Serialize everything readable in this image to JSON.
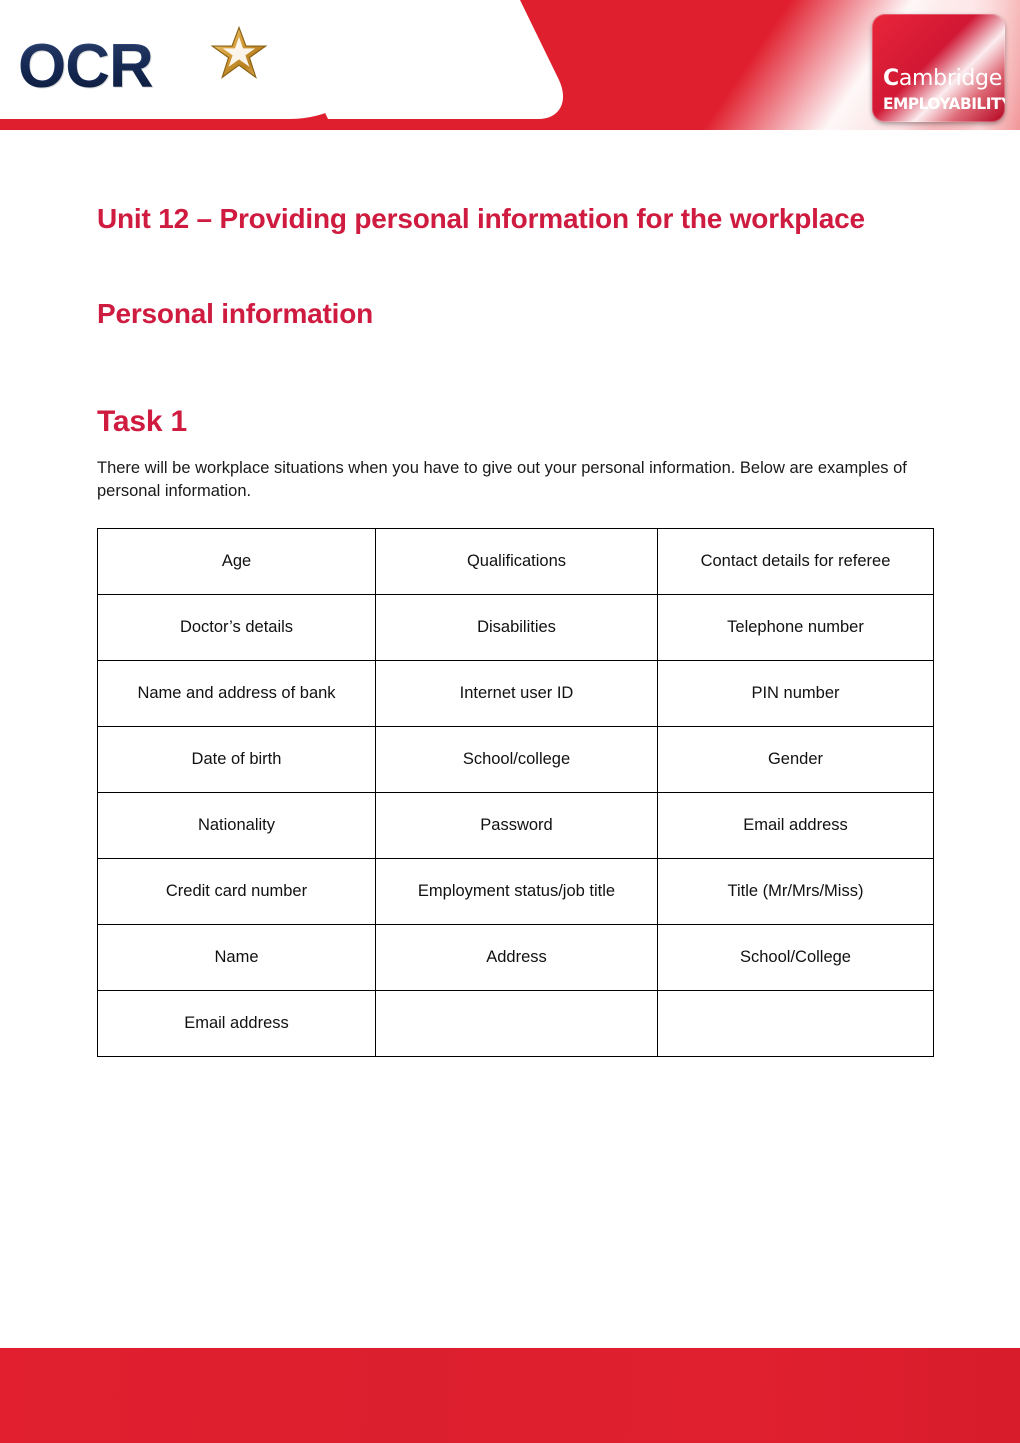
{
  "header": {
    "ocr_logo": {
      "text": "OCR",
      "star_icon": "star-icon",
      "navy": "#1b3263",
      "gold": "#D9A441"
    },
    "cambridge_badge": {
      "word_c": "C",
      "word_rest": "ambridge",
      "subtitle": "EMPLOYABILITY",
      "badge_color": "#CF1633"
    },
    "band_color": "#E01F2E"
  },
  "document": {
    "page_title": "Unit 12 – Providing personal information for the workplace",
    "section_title": "Personal information",
    "task_title": "Task 1",
    "intro_paragraph": "There will be workplace situations when you have to give out your personal information.  Below are examples of personal information.",
    "heading_color": "#CE1B3F"
  },
  "table": {
    "columns": 3,
    "rows": [
      [
        "Age",
        "Qualifications",
        "Contact details for referee"
      ],
      [
        "Doctor’s details",
        "Disabilities",
        "Telephone number"
      ],
      [
        "Name and address of bank",
        "Internet user ID",
        "PIN number"
      ],
      [
        "Date of birth",
        "School/college",
        "Gender"
      ],
      [
        "Nationality",
        "Password",
        "Email address"
      ],
      [
        "Credit card number",
        "Employment status/job title",
        "Title (Mr/Mrs/Miss)"
      ],
      [
        "Name",
        "Address",
        "School/College"
      ],
      [
        "Email address",
        "",
        ""
      ]
    ]
  },
  "footer": {
    "band_color": "#DE1F2E"
  }
}
